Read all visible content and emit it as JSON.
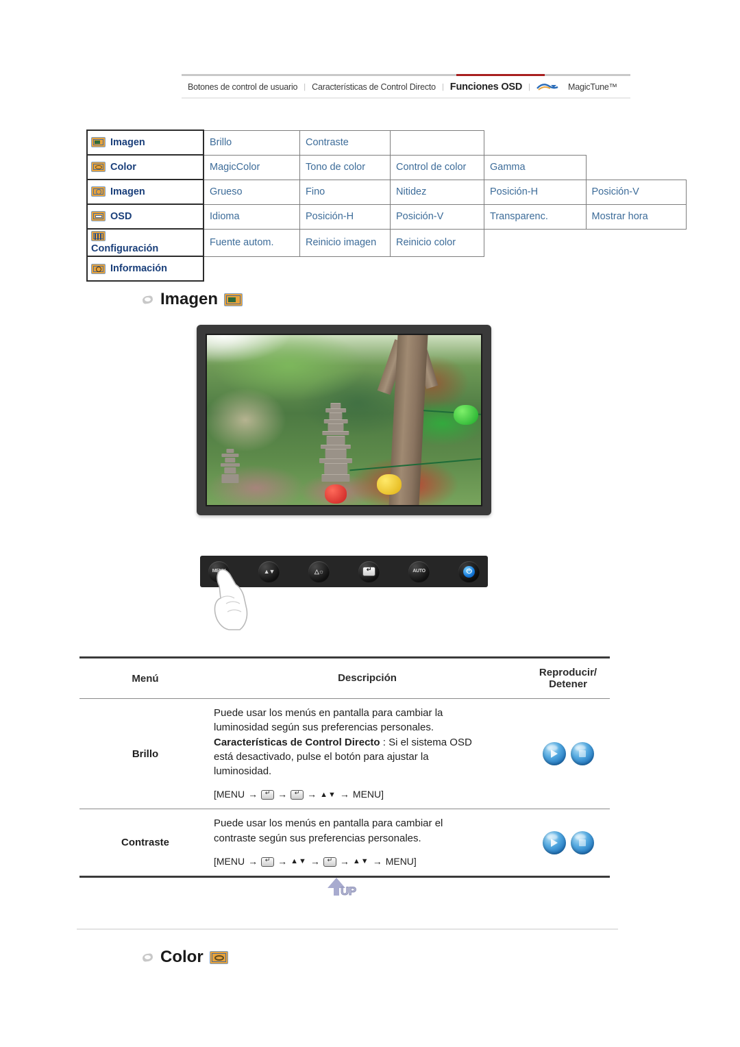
{
  "topnav": {
    "items": [
      {
        "label": "Botones de control de usuario",
        "active": false
      },
      {
        "label": "Características de Control Directo",
        "active": false
      },
      {
        "label": "Funciones OSD",
        "active": true
      }
    ],
    "brand": "MagicTune™",
    "brand_logo_icon": "magictune-logo-icon",
    "separator": "|",
    "active_color": "#a81f1f"
  },
  "menu_matrix": {
    "rows": [
      {
        "icon": "picture-icon",
        "category": "Imagen",
        "items": [
          "Brillo",
          "Contraste"
        ]
      },
      {
        "icon": "color-icon",
        "category": "Color",
        "items": [
          "MagicColor",
          "Tono de color",
          "Control de color",
          "Gamma"
        ]
      },
      {
        "icon": "geometry-icon",
        "category": "Imagen",
        "items": [
          "Grueso",
          "Fino",
          "Nitidez",
          "Posición-H",
          "Posición-V"
        ]
      },
      {
        "icon": "osd-icon",
        "category": "OSD",
        "items": [
          "Idioma",
          "Posición-H",
          "Posición-V",
          "Transparenc.",
          "Mostrar hora"
        ]
      },
      {
        "icon": "setup-icon",
        "category": "Configuración",
        "items": [
          "Fuente autom.",
          "Reinicio imagen",
          "Reinicio color"
        ]
      },
      {
        "icon": "information-icon",
        "category": "Información",
        "items": []
      }
    ],
    "link_color": "#3d6c99",
    "category_color": "#1a3f7a"
  },
  "section_imagen": {
    "title": "Imagen",
    "bullet_icon": "bullet-icon",
    "badge_icon": "picture-badge-icon"
  },
  "section_color": {
    "title": "Color",
    "bullet_icon": "bullet-icon",
    "badge_icon": "color-badge-icon"
  },
  "monitor": {
    "alt": "Monitor mostrando una fotografía de una pagoda de piedra en un jardín con árboles y faroles de colores"
  },
  "button_bar": {
    "buttons": [
      {
        "name": "menu-button",
        "label": "MENU"
      },
      {
        "name": "source-updown-button",
        "label": ""
      },
      {
        "name": "brightness-button",
        "label": ""
      },
      {
        "name": "enter-button",
        "label": ""
      },
      {
        "name": "auto-button",
        "label": "AUTO"
      },
      {
        "name": "power-button",
        "label": ""
      }
    ],
    "hand_cursor": "hand-pointing-icon"
  },
  "desc_table": {
    "headers": {
      "menu": "Menú",
      "description": "Descripción",
      "play_stop": "Reproducir/ Detener",
      "play_stop_line1": "Reproducir/",
      "play_stop_line2": "Detener"
    },
    "rows": [
      {
        "menu": "Brillo",
        "desc_line1": "Puede usar los menús en pantalla para cambiar la",
        "desc_line2": "luminosidad según sus preferencias personales.",
        "desc_bold": "Características de Control Directo",
        "desc_line3": " : Si el sistema OSD",
        "desc_line4": "está desactivado, pulse el botón para ajustar la",
        "desc_line5": "luminosidad.",
        "sequence": [
          "[MENU",
          "→",
          "key",
          "→",
          "key",
          "→",
          "updown",
          "→",
          "MENU]"
        ],
        "seq_open": "[MENU",
        "seq_close": "MENU]",
        "play_label": "play-button",
        "stop_label": "stop-button"
      },
      {
        "menu": "Contraste",
        "desc_line1": "Puede usar los menús en pantalla para cambiar el",
        "desc_line2": "contraste según sus preferencias personales.",
        "desc_bold": "",
        "desc_line3": "",
        "desc_line4": "",
        "desc_line5": "",
        "seq_open": "[MENU",
        "seq_close": "MENU]",
        "play_label": "play-button",
        "stop_label": "stop-button"
      }
    ]
  },
  "up_button": {
    "label": "UP",
    "icon": "up-arrow-icon"
  }
}
